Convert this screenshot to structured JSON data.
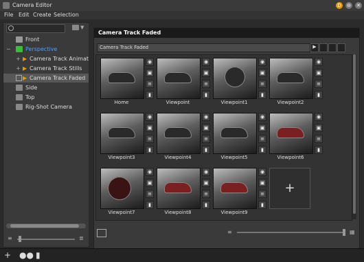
{
  "window": {
    "title": "Camera Editor"
  },
  "menu": [
    {
      "label": "File"
    },
    {
      "label": "Edit"
    },
    {
      "label": "Create"
    },
    {
      "label": "Selection"
    }
  ],
  "tree": {
    "items": [
      {
        "label": "Front"
      },
      {
        "label": "Perspective"
      },
      {
        "label": "Camera Track Animated"
      },
      {
        "label": "Camera Track Stills"
      },
      {
        "label": "Camera Track Faded"
      },
      {
        "label": "Side"
      },
      {
        "label": "Top"
      },
      {
        "label": "Rig-Shot Camera"
      }
    ]
  },
  "main": {
    "header": "Camera Track Faded",
    "name_value": "Camera Track Faded",
    "viewpoints": [
      {
        "label": "Home"
      },
      {
        "label": "Viewpoint"
      },
      {
        "label": "Viewpoint1"
      },
      {
        "label": "Viewpoint2"
      },
      {
        "label": "Viewpoint3"
      },
      {
        "label": "Viewpoint4"
      },
      {
        "label": "Viewpoint5"
      },
      {
        "label": "Viewpoint6"
      },
      {
        "label": "Viewpoint7"
      },
      {
        "label": "Viewpoint8"
      },
      {
        "label": "Viewpoint9"
      }
    ],
    "add_tile": "+"
  },
  "colors": {
    "accent_green": "#3dbb3d",
    "perspective_blue": "#4aa0ff",
    "close_orange": "#e69a00",
    "selected_row": "#575757"
  },
  "icons": {
    "add": "+",
    "camera": "camera-icon",
    "tool": "wrench-icon"
  }
}
